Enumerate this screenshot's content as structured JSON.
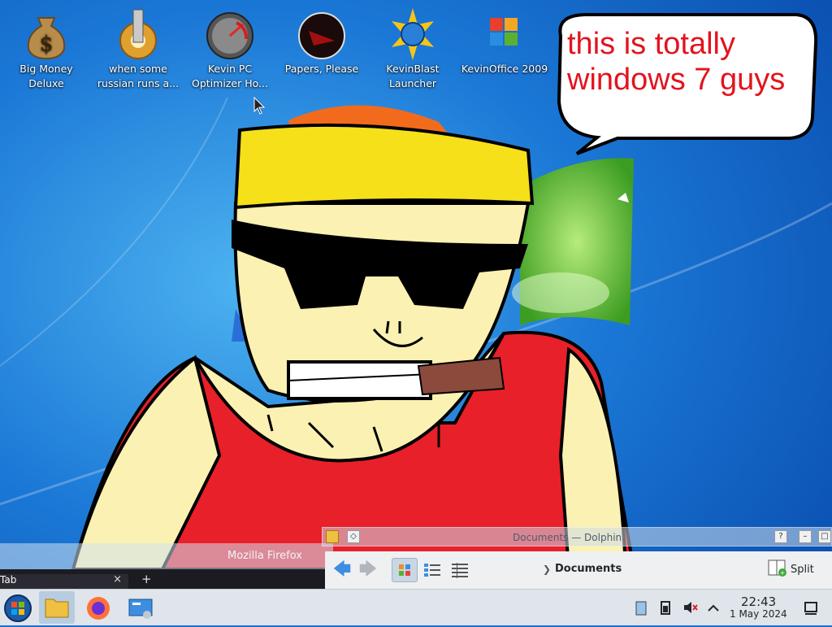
{
  "desktop_icons": [
    {
      "label": "Big Money Deluxe",
      "icon": "money-bag-icon"
    },
    {
      "label": "when some russian runs a...",
      "icon": "gear-syringe-icon"
    },
    {
      "label": "Kevin PC Optimizer Ho...",
      "icon": "speedometer-icon"
    },
    {
      "label": "Papers, Please",
      "icon": "papers-please-icon"
    },
    {
      "label": "KevinBlast Launcher",
      "icon": "globe-burst-icon"
    },
    {
      "label": "KevinOffice 2009",
      "icon": "office-logo-icon"
    }
  ],
  "speech_bubble": {
    "text": "this is totally windows 7 guys",
    "color": "#e2141f"
  },
  "firefox": {
    "window_title": "Mozilla Firefox",
    "tab_label": "Tab",
    "tab_close": "×",
    "new_tab": "+"
  },
  "dolphin": {
    "window_title": "Documents — Dolphin",
    "title_help": "?",
    "breadcrumb": "Documents",
    "split_label": "Split"
  },
  "taskbar": {
    "time": "22:43",
    "date": "1 May 2024",
    "tray_icons": [
      "clipboard-icon",
      "battery-icon",
      "volume-muted-icon",
      "chevron-up-icon",
      "show-desktop-icon"
    ]
  },
  "colors": {
    "wallpaper": "#1a6fd0",
    "hat": "#f5e01a",
    "shirt": "#e8202a",
    "skin": "#fbf1b2"
  }
}
